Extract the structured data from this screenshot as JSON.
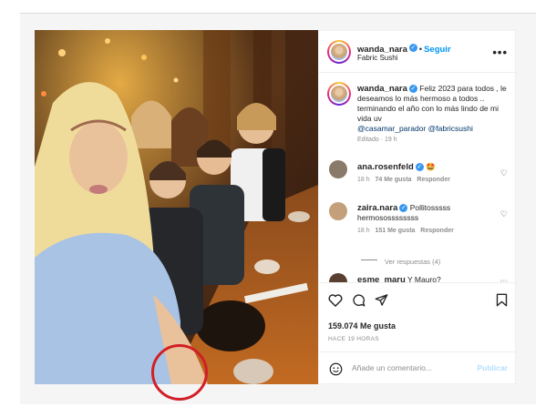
{
  "post": {
    "username": "wanda_nara",
    "follow_label": "Seguir",
    "location": "Fabric Sushi",
    "more_label": "•••"
  },
  "caption": {
    "username": "wanda_nara",
    "text": "Feliz 2023 para todos , le deseamos lo más hermoso a todos .. terminando el año con lo más lindo de mi vida uv",
    "mention1": "@casamar_parador",
    "mention2": "@fabricsushi",
    "edited": "Editado · 19 h"
  },
  "comments": [
    {
      "username": "ana.rosenfeld",
      "text": "🤩",
      "time": "18 h",
      "likes": "74 Me gusta",
      "reply": "Responder"
    },
    {
      "username": "zaira.nara",
      "text": "Pollitosssss hermosossssssss",
      "time": "18 h",
      "likes": "151 Me gusta",
      "reply": "Responder"
    },
    {
      "username": "esme_maru",
      "text": "Y Mauro?"
    }
  ],
  "view_replies": "Ver respuestas (4)",
  "actions": {
    "likes_count": "159.074 Me gusta",
    "time_ago": "HACE 19 HORAS"
  },
  "add_comment": {
    "placeholder": "Añade un comentario...",
    "publish_label": "Publicar"
  },
  "colors": {
    "link_blue": "#0095f6",
    "verified_blue": "#3897f0",
    "highlight_circle": "#d21f26"
  }
}
